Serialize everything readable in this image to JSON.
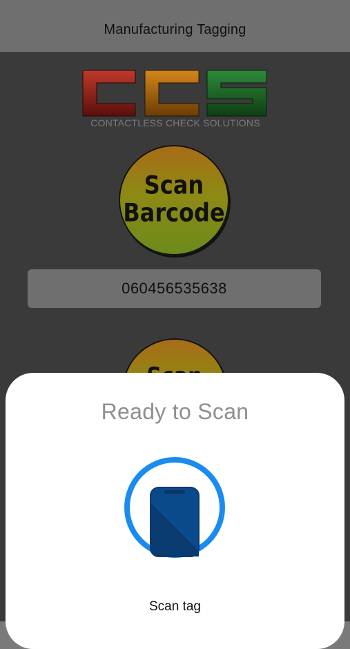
{
  "nav": {
    "title": "Manufacturing Tagging"
  },
  "logo": {
    "letters": "CCS",
    "tagline": "CONTACTLESS CHECK SOLUTIONS"
  },
  "scan_barcode_button": {
    "line1": "Scan",
    "line2": "Barcode"
  },
  "barcode_field": {
    "value": "060456535638"
  },
  "scan_tag_button": {
    "line1": "Scan"
  },
  "nfc_sheet": {
    "title": "Ready to Scan",
    "icon": "phone-nfc-icon",
    "caption": "Scan tag",
    "accent_color": "#1a8cf0"
  }
}
